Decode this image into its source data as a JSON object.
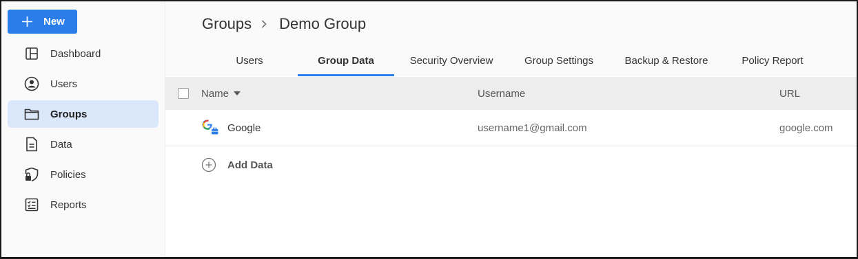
{
  "sidebar": {
    "new_button": "New",
    "items": [
      {
        "label": "Dashboard",
        "icon": "dashboard-icon"
      },
      {
        "label": "Users",
        "icon": "user-circle-icon"
      },
      {
        "label": "Groups",
        "icon": "folder-icon",
        "active": true
      },
      {
        "label": "Data",
        "icon": "document-icon"
      },
      {
        "label": "Policies",
        "icon": "shield-lock-icon"
      },
      {
        "label": "Reports",
        "icon": "checklist-icon"
      }
    ]
  },
  "breadcrumb": {
    "parent": "Groups",
    "current": "Demo Group"
  },
  "tabs": [
    {
      "label": "Users"
    },
    {
      "label": "Group Data",
      "active": true
    },
    {
      "label": "Security Overview"
    },
    {
      "label": "Group Settings"
    },
    {
      "label": "Backup & Restore"
    },
    {
      "label": "Policy Report"
    }
  ],
  "table": {
    "columns": [
      "Name",
      "Username",
      "URL"
    ],
    "rows": [
      {
        "name": "Google",
        "username": "username1@gmail.com",
        "url": "google.com",
        "icon": "google-icon"
      }
    ],
    "add_label": "Add Data"
  },
  "colors": {
    "accent": "#2b7de9",
    "active_nav": "#dbe7fb"
  }
}
